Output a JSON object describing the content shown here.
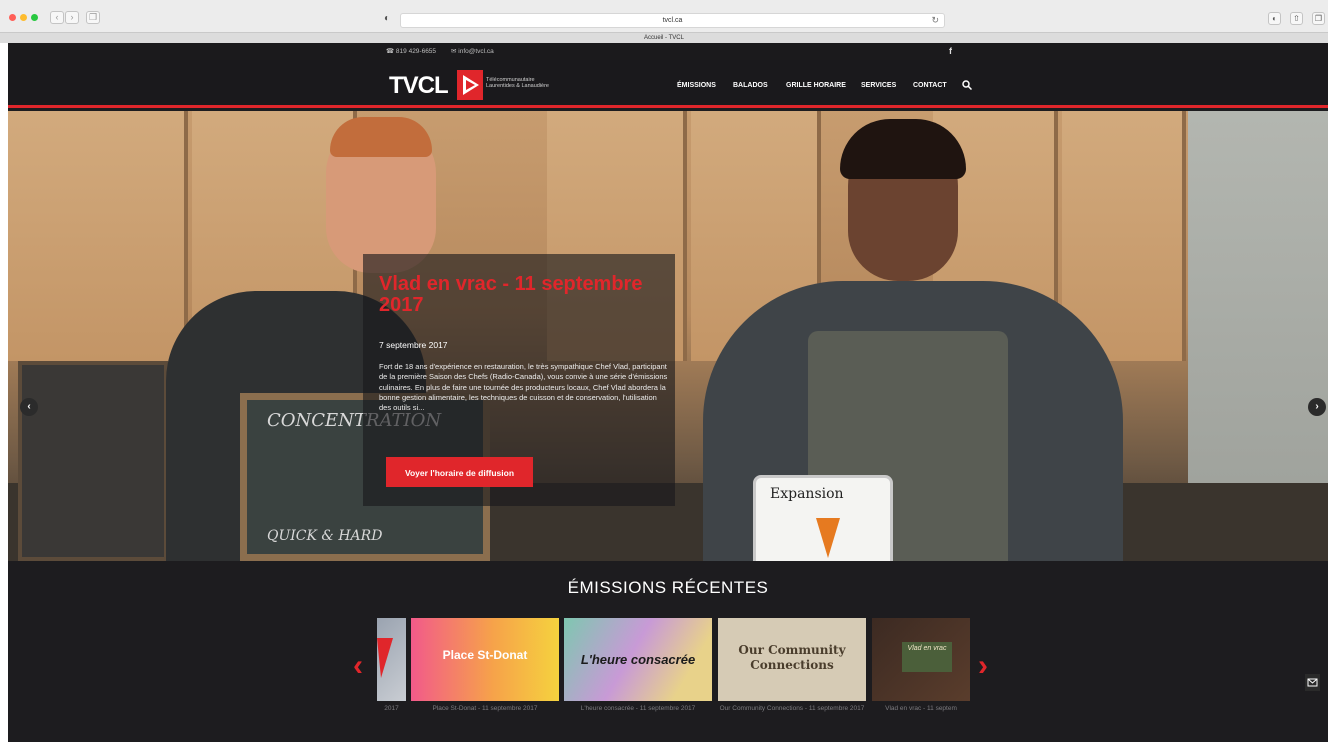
{
  "browser": {
    "url": "tvcl.ca",
    "tab_title": "Accueil - TVCL",
    "back": "‹",
    "forward": "›",
    "reader": "❐",
    "reload": "↻"
  },
  "topbar": {
    "phone": "819 429-6655",
    "email": "info@tvcl.ca",
    "facebook": "f"
  },
  "header": {
    "logo": "TVCL",
    "logo_sub_line1": "Télécommunautaire",
    "logo_sub_line2": "Laurentides & Lanaudière",
    "menu": [
      "ÉMISSIONS",
      "BALADOS",
      "GRILLE HORAIRE",
      "SERVICES",
      "CONTACT"
    ]
  },
  "hero": {
    "title": "Vlad en vrac - 11 septembre 2017",
    "date": "7 septembre 2017",
    "text": "Fort de 18 ans d'expérience en restauration, le très sympathique Chef Vlad, participant de la première Saison des Chefs (Radio-Canada), vous convie à une série d'émissions culinaires. En plus de faire une tournée des producteurs locaux, Chef Vlad abordera la bonne gestion alimentaire, les techniques de cuisson et de conservation, l'utilisation des outils si...",
    "button": "Voyer l'horaire de diffusion",
    "prev": "‹",
    "next": "›",
    "chalk_word": "CONCENTRATION",
    "chalk_word2": "QUICK & HARD",
    "whiteboard_word": "Expansion"
  },
  "recent": {
    "title": "ÉMISSIONS RÉCENTES",
    "prev": "‹",
    "next": "›",
    "items": [
      {
        "thumb": "",
        "caption": "2017"
      },
      {
        "thumb": "Place St-Donat",
        "caption": "Place St-Donat - 11 septembre 2017"
      },
      {
        "thumb": "L'heure consacrée",
        "caption": "L'heure consacrée - 11 septembre 2017"
      },
      {
        "thumb": "Our Community Connections",
        "caption": "Our Community Connections - 11 septembre 2017"
      },
      {
        "thumb": "Vlad en vrac",
        "caption": "Vlad en vrac - 11 septem"
      }
    ]
  },
  "colors": {
    "accent": "#e0262b",
    "background": "#1d1c1f"
  }
}
